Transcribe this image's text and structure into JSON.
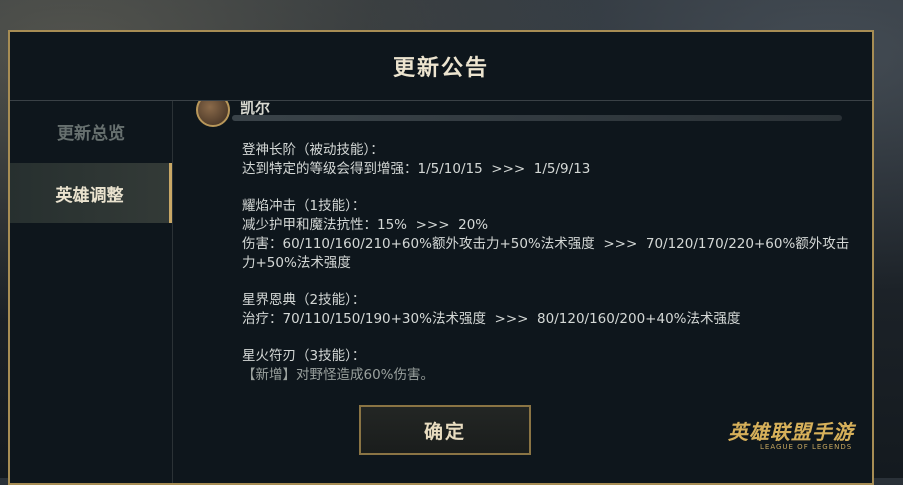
{
  "dialog": {
    "title": "更新公告"
  },
  "sidebar": {
    "tabs": [
      {
        "label": "更新总览",
        "active": false
      },
      {
        "label": "英雄调整",
        "active": true
      }
    ]
  },
  "hero": {
    "name": "凯尔"
  },
  "skills": [
    {
      "name": "登神长阶（被动技能）：",
      "lines": [
        "达到特定的等级会得到增强：1/5/10/15  >>>  1/5/9/13"
      ]
    },
    {
      "name": "耀焰冲击（1技能）：",
      "lines": [
        "减少护甲和魔法抗性：15%  >>>  20%",
        "伤害：60/110/160/210+60%额外攻击力+50%法术强度  >>>  70/120/170/220+60%额外攻击力+50%法术强度"
      ]
    },
    {
      "name": "星界恩典（2技能）：",
      "lines": [
        "治疗：70/110/150/190+30%法术强度  >>>  80/120/160/200+40%法术强度"
      ]
    },
    {
      "name": "星火符刃（3技能）：",
      "lines": [
        "【新增】对野怪造成60%伤害。"
      ]
    }
  ],
  "footer": {
    "confirm_label": "确定",
    "logo_text": "英雄联盟手游",
    "logo_sub": "LEAGUE OF LEGENDS"
  }
}
